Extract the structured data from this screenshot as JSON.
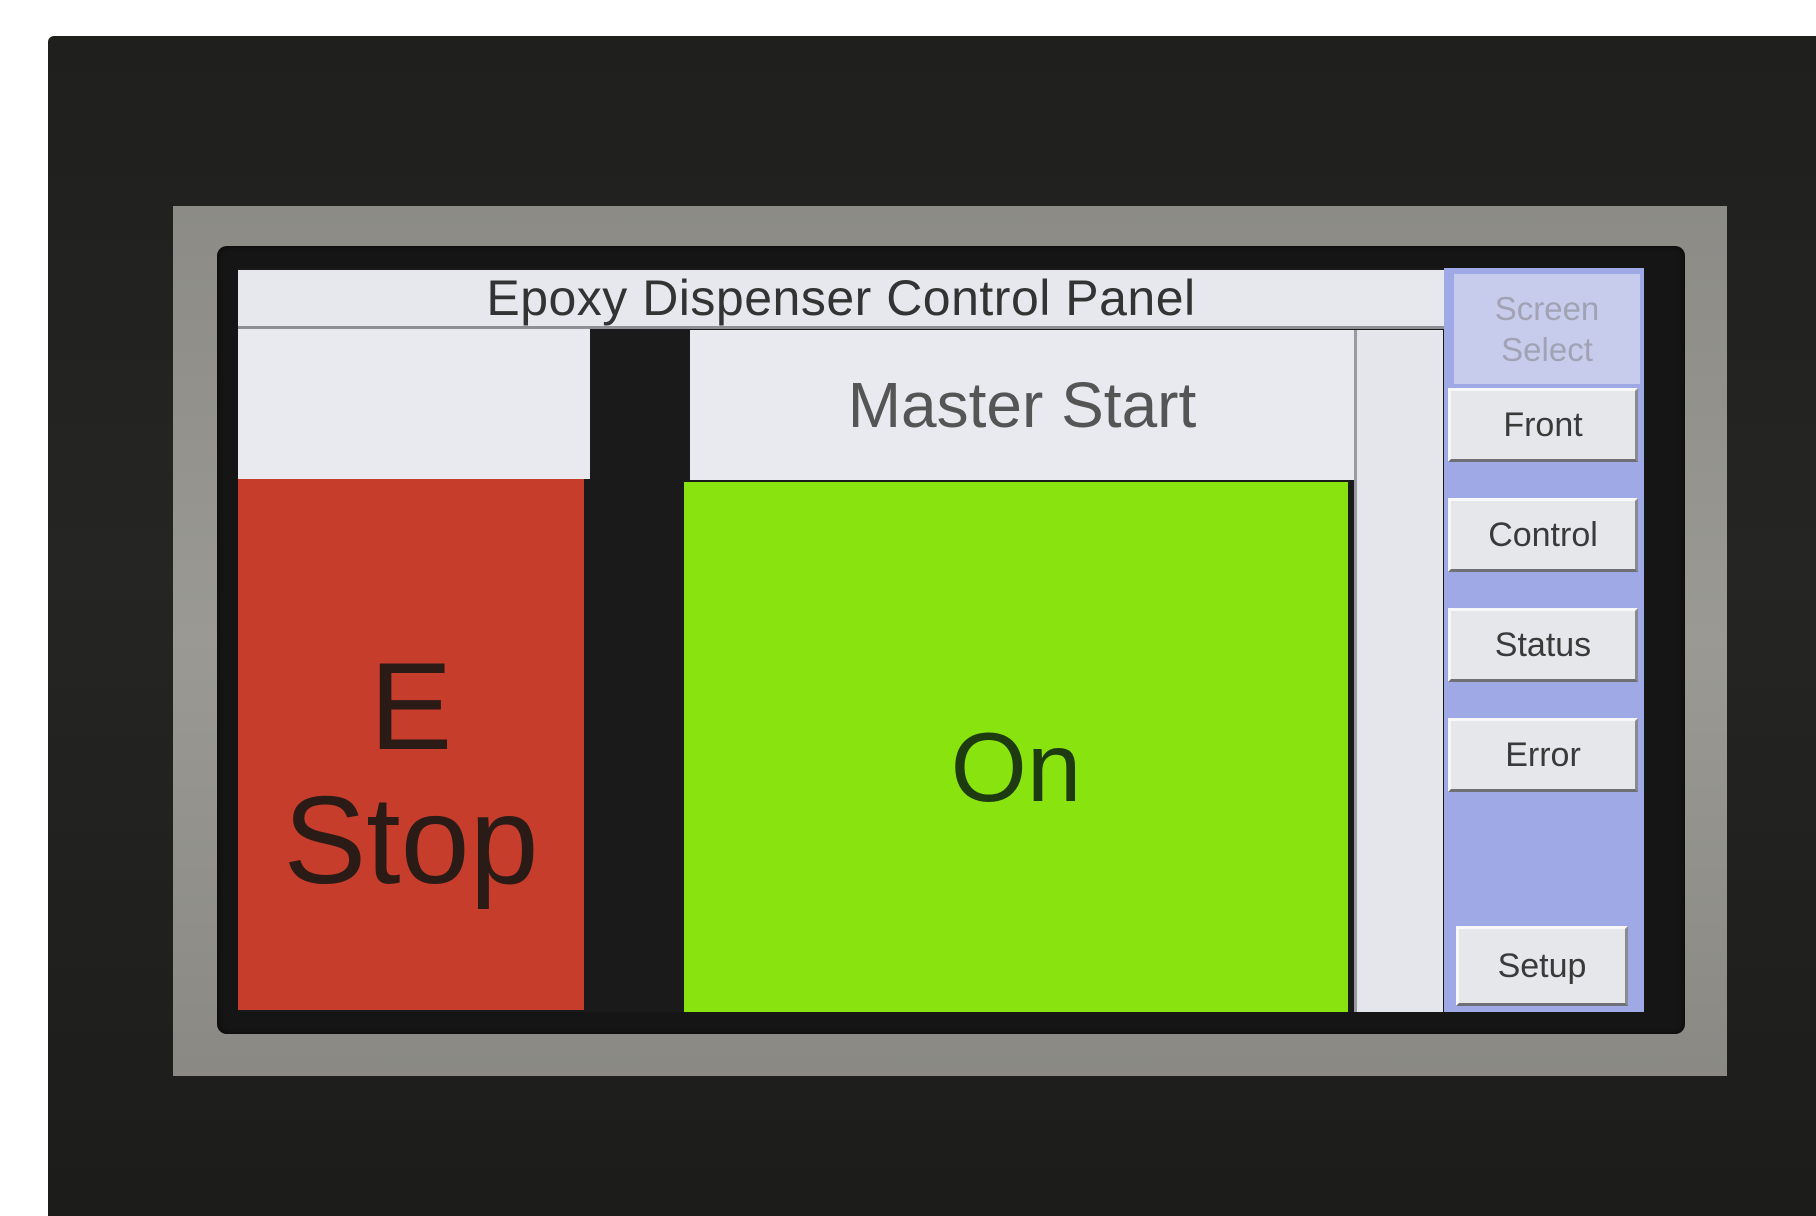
{
  "screen": {
    "title": "Epoxy Dispenser Control Panel"
  },
  "estop": {
    "line1": "E",
    "line2": "Stop",
    "color": "#c63d2b"
  },
  "master": {
    "header": "Master Start",
    "state": "On",
    "color": "#89e30e"
  },
  "nav": {
    "title_line1": "Screen",
    "title_line2": "Select",
    "items": [
      {
        "label": "Front"
      },
      {
        "label": "Control"
      },
      {
        "label": "Status"
      },
      {
        "label": "Error"
      },
      {
        "label": "Setup"
      }
    ],
    "panel_color": "#9ea9e6"
  }
}
